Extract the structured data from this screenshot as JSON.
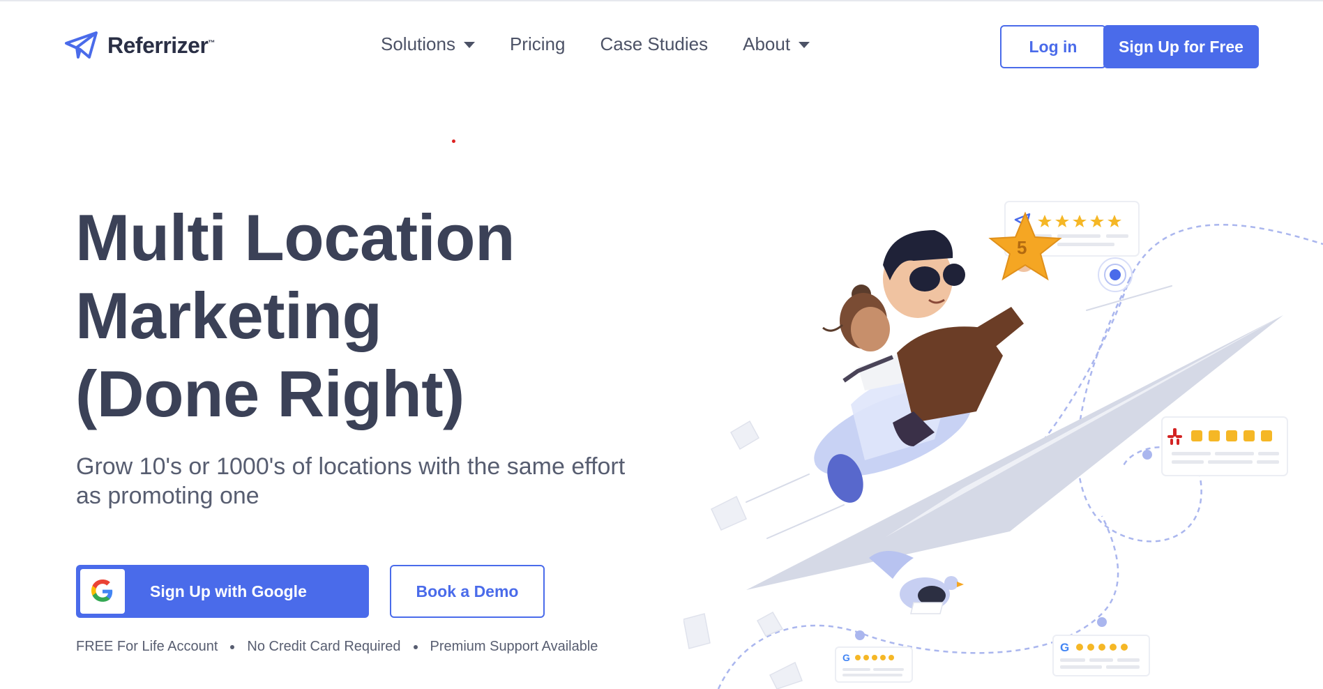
{
  "brand": {
    "name": "Referrizer",
    "tm": "™"
  },
  "nav": {
    "items": [
      {
        "label": "Solutions",
        "has_dropdown": true
      },
      {
        "label": "Pricing",
        "has_dropdown": false
      },
      {
        "label": "Case Studies",
        "has_dropdown": false
      },
      {
        "label": "About",
        "has_dropdown": true
      }
    ]
  },
  "header": {
    "login_label": "Log in",
    "signup_label": "Sign Up for Free"
  },
  "hero": {
    "title_line1": "Multi Location",
    "title_line2": "Marketing",
    "title_line3": "(Done Right)",
    "subtitle": "Grow 10's or 1000's of locations with the same effort as promoting one",
    "google_button_label": "Sign Up with Google",
    "demo_button_label": "Book a Demo",
    "features": [
      "FREE For Life Account",
      "No Credit Card Required",
      "Premium Support Available"
    ]
  },
  "illustration": {
    "star_badge_value": "5",
    "icons": [
      "paper-plane-icon",
      "yelp-icon",
      "google-icon"
    ]
  },
  "colors": {
    "accent": "#4a6bea",
    "text_dark": "#3b4157",
    "star": "#f5b726"
  }
}
